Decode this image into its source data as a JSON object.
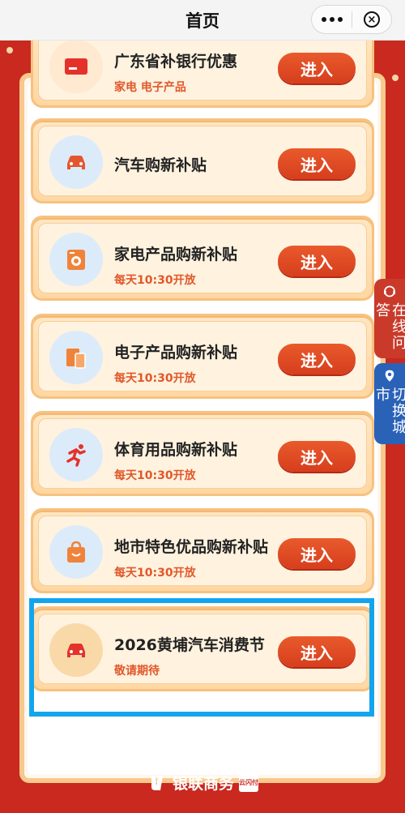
{
  "header": {
    "title": "首页"
  },
  "cards": [
    {
      "title": "广东省补银行优惠",
      "subtitle": "家电 电子产品",
      "button": "进入",
      "icon": "bank-card-icon"
    },
    {
      "title": "汽车购新补贴",
      "subtitle": "",
      "button": "进入",
      "icon": "car-icon"
    },
    {
      "title": "家电产品购新补贴",
      "subtitle": "每天10:30开放",
      "button": "进入",
      "icon": "washing-machine-icon"
    },
    {
      "title": "电子产品购新补贴",
      "subtitle": "每天10:30开放",
      "button": "进入",
      "icon": "phone-tablet-icon"
    },
    {
      "title": "体育用品购新补贴",
      "subtitle": "每天10:30开放",
      "button": "进入",
      "icon": "runner-icon"
    },
    {
      "title": "地市特色优品购新补贴",
      "subtitle": "每天10:30开放",
      "button": "进入",
      "icon": "shopping-bag-icon"
    },
    {
      "title": "2026黄埔汽车消费节",
      "subtitle": "敬请期待",
      "button": "进入",
      "icon": "car-icon"
    }
  ],
  "side": {
    "chat": "在线问答",
    "city": "切换城市"
  },
  "footer": {
    "brand": "银联商务",
    "badge": "云闪付"
  },
  "colors": {
    "accent": "#d63e1d",
    "background": "#c9291f",
    "highlight": "#12a5ee"
  }
}
